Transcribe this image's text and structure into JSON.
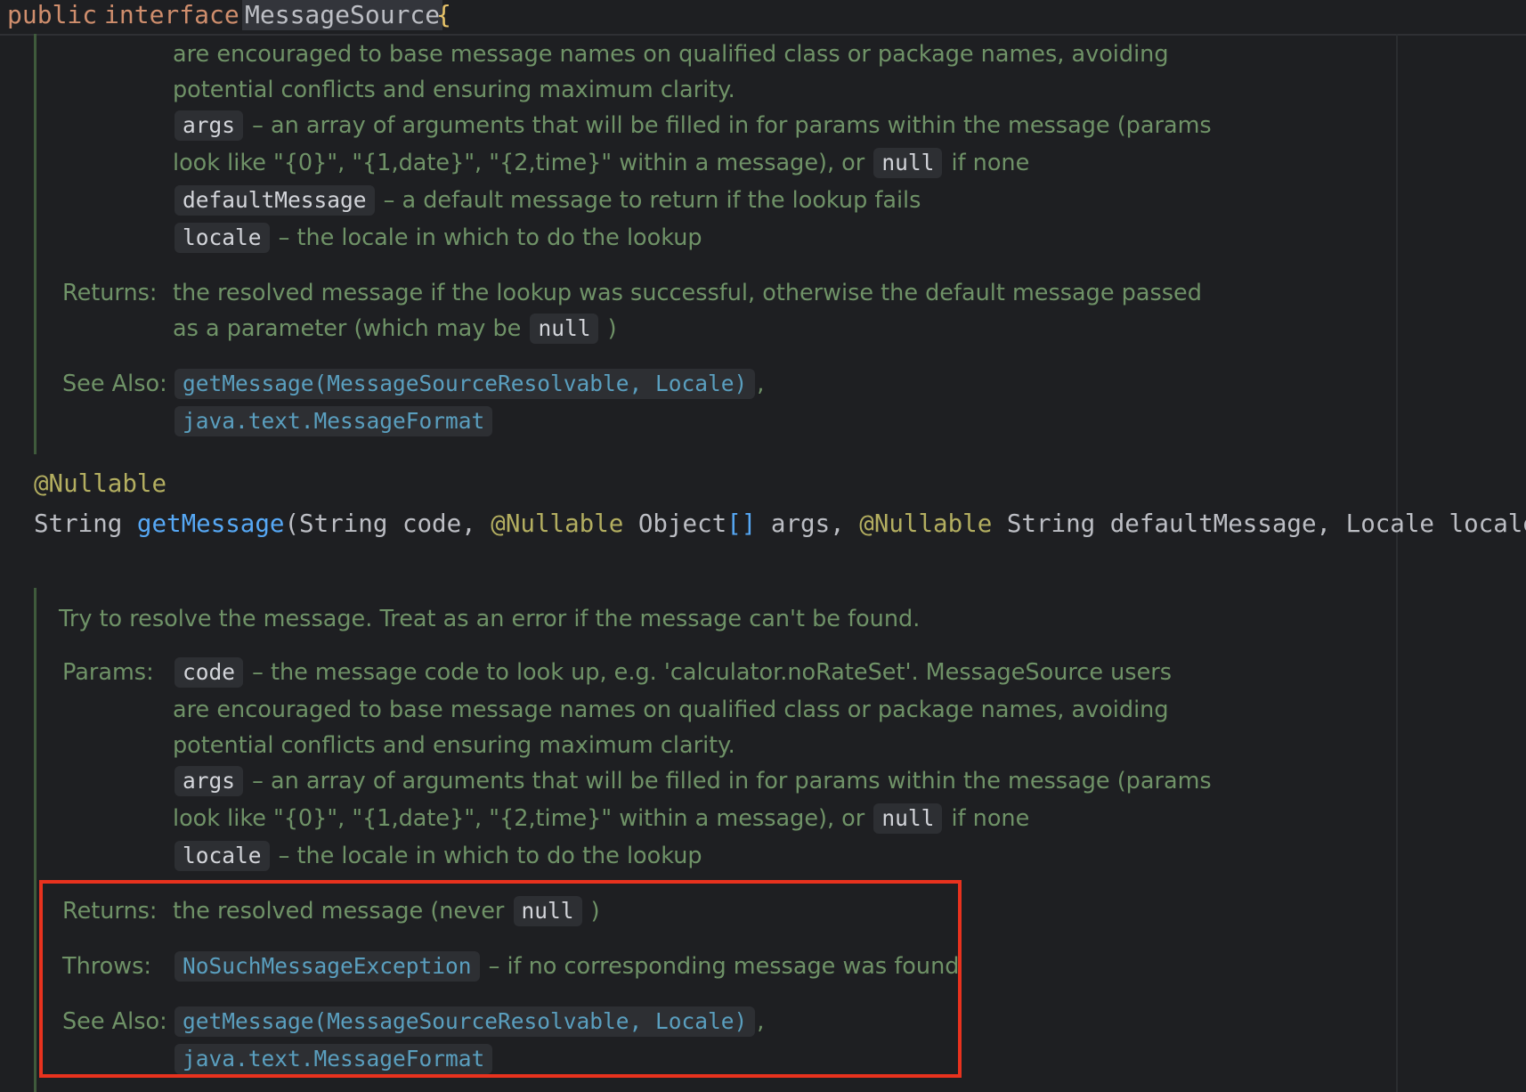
{
  "header": {
    "keyword1": "public",
    "keyword2": "interface",
    "class_name": "MessageSource",
    "brace": "{"
  },
  "doc1": {
    "params_cont_line1": "are encouraged to base message names on qualified class or package names, avoiding",
    "params_cont_line2": "potential conflicts and ensuring maximum clarity.",
    "args_name": "args",
    "args_text1": "– an array of arguments that will be filled in for params within the message (params",
    "args_text2a": "look like \"{0}\", \"{1,date}\", \"{2,time}\" within a message), or",
    "args_null": "null",
    "args_text2b": "if none",
    "default_name": "defaultMessage",
    "default_text": "– a default message to return if the lookup fails",
    "locale_name": "locale",
    "locale_text": "– the locale in which to do the lookup",
    "returns_label": "Returns:",
    "returns_text1": "the resolved message if the lookup was successful, otherwise the default message passed",
    "returns_text2a": "as a parameter (which may be",
    "returns_null": "null",
    "returns_text2b": ")",
    "see_label": "See Also:",
    "see_link1": "getMessage(MessageSourceResolvable, Locale)",
    "see_comma": ",",
    "see_link2": "java.text.MessageFormat"
  },
  "code": {
    "annotation": "@Nullable",
    "ret_type": "String",
    "method": "getMessage",
    "open": "(",
    "p1": "String code,",
    "a2": "@Nullable",
    "p2type": "Object",
    "brackets": "[]",
    "p2name": "args,",
    "a3": "@Nullable",
    "p3": "String defaultMessage, Locale locale",
    "close": ");"
  },
  "doc2": {
    "summary": "Try to resolve the message. Treat as an error if the message can't be found.",
    "params_label": "Params:",
    "code_name": "code",
    "code_text": "– the message code to look up, e.g. 'calculator.noRateSet'. MessageSource users",
    "params_cont_line1": "are encouraged to base message names on qualified class or package names, avoiding",
    "params_cont_line2": "potential conflicts and ensuring maximum clarity.",
    "args_name": "args",
    "args_text1": "– an array of arguments that will be filled in for params within the message (params",
    "args_text2a": "look like \"{0}\", \"{1,date}\", \"{2,time}\" within a message), or",
    "args_null": "null",
    "args_text2b": "if none",
    "locale_name": "locale",
    "locale_text": "– the locale in which to do the lookup",
    "returns_label": "Returns:",
    "returns_text_a": "the resolved message (never",
    "returns_null": "null",
    "returns_text_b": ")",
    "throws_label": "Throws:",
    "throws_link": "NoSuchMessageException",
    "throws_text": "– if no corresponding message was found",
    "see_label": "See Also:",
    "see_link1": "getMessage(MessageSourceResolvable, Locale)",
    "see_comma": ",",
    "see_link2": "java.text.MessageFormat"
  },
  "colors": {
    "background": "#1e1f22",
    "doc_text": "#6f9267",
    "link": "#5a9fbf",
    "highlight_box": "#e8321e"
  }
}
